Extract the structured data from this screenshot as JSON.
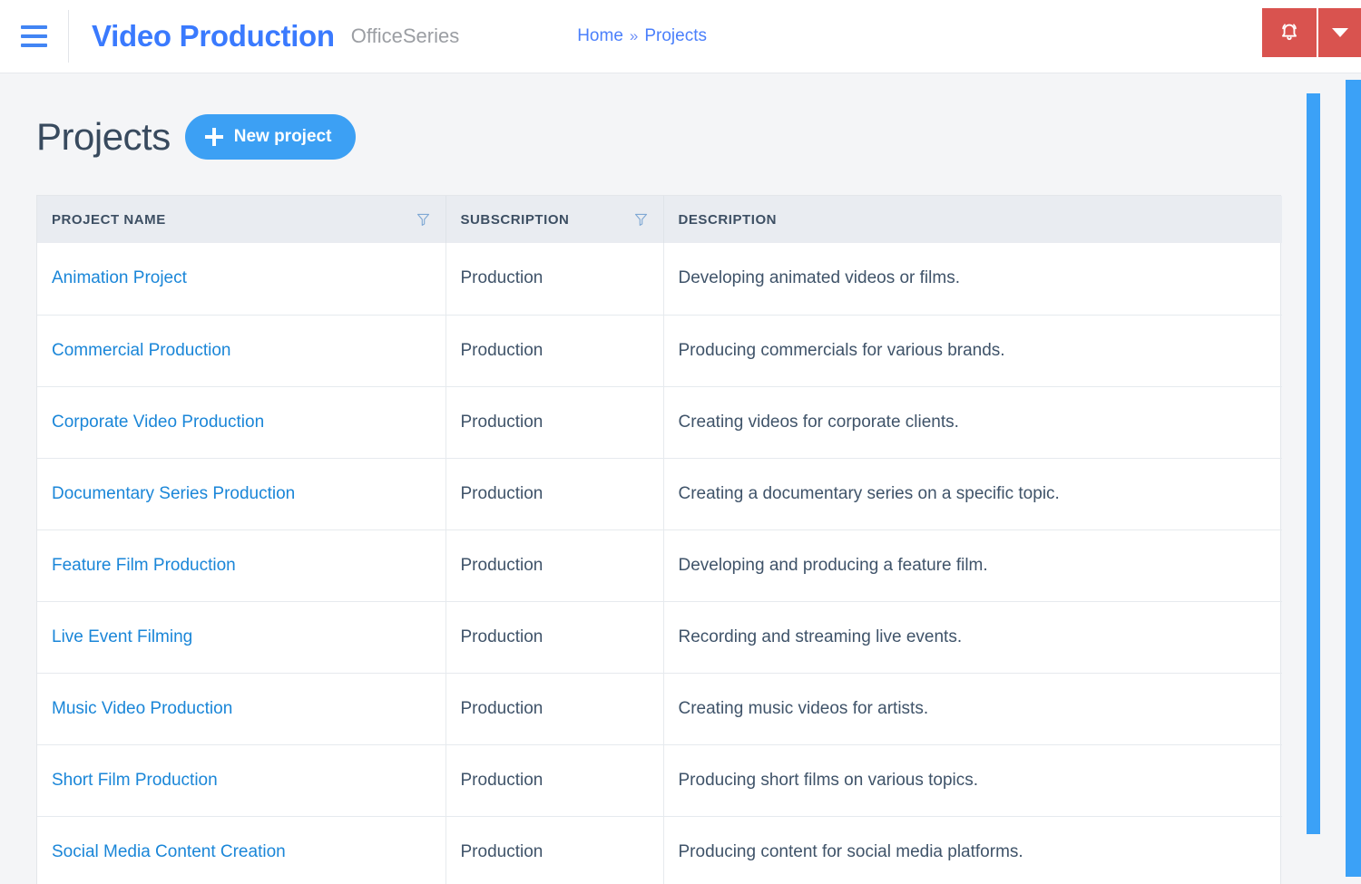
{
  "topbar": {
    "menu_icon": "hamburger-icon",
    "brand": "Video Production",
    "brand_suffix": "OfficeSeries",
    "breadcrumb": {
      "home": "Home",
      "separator": "»",
      "current": "Projects"
    },
    "actions": {
      "notifications_icon": "bell-icon",
      "dropdown_icon": "caret-down-icon"
    },
    "colors": {
      "brand": "#3a7afe",
      "action_button": "#d9534f"
    }
  },
  "main": {
    "title": "Projects",
    "new_button": {
      "label": "New project",
      "icon": "plus-icon",
      "color": "#3ca0f4"
    },
    "table": {
      "columns": [
        {
          "label": "PROJECT NAME",
          "filter_icon": "funnel-icon",
          "filterable": true
        },
        {
          "label": "SUBSCRIPTION",
          "filter_icon": "funnel-icon",
          "filterable": true
        },
        {
          "label": "DESCRIPTION",
          "filter_icon": null,
          "filterable": false
        }
      ],
      "rows": [
        {
          "name": "Animation Project",
          "subscription": "Production",
          "description": "Developing animated videos or films."
        },
        {
          "name": "Commercial Production",
          "subscription": "Production",
          "description": "Producing commercials for various brands."
        },
        {
          "name": "Corporate Video Production",
          "subscription": "Production",
          "description": "Creating videos for corporate clients."
        },
        {
          "name": "Documentary Series Production",
          "subscription": "Production",
          "description": "Creating a documentary series on a specific topic."
        },
        {
          "name": "Feature Film Production",
          "subscription": "Production",
          "description": "Developing and producing a feature film."
        },
        {
          "name": "Live Event Filming",
          "subscription": "Production",
          "description": "Recording and streaming live events."
        },
        {
          "name": "Music Video Production",
          "subscription": "Production",
          "description": "Creating music videos for artists."
        },
        {
          "name": "Short Film Production",
          "subscription": "Production",
          "description": "Producing short films on various topics."
        },
        {
          "name": "Social Media Content Creation",
          "subscription": "Production",
          "description": "Producing content for social media platforms."
        }
      ]
    }
  },
  "scrollbars": {
    "inner_thumb_color": "#3ba1f7",
    "outer_thumb_color": "#3ba1f7"
  }
}
